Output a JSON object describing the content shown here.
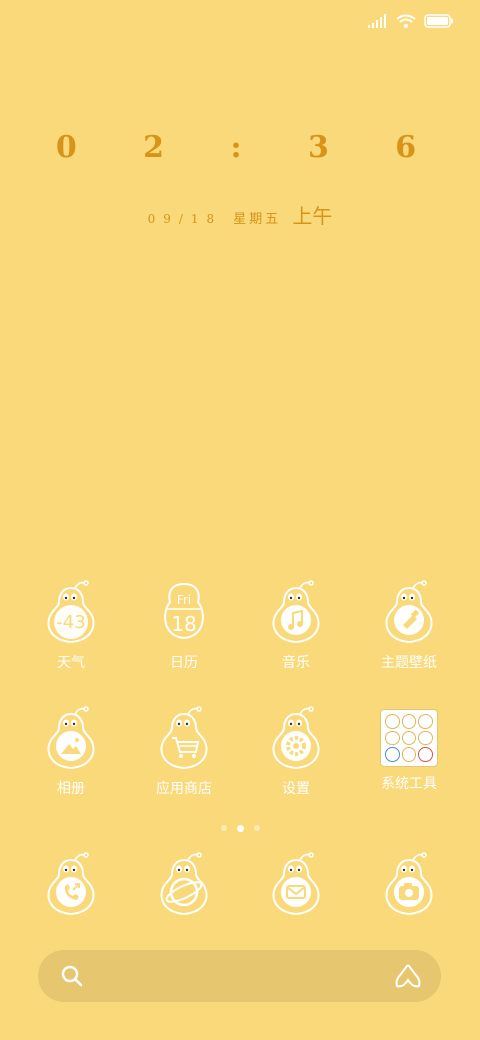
{
  "status_bar": {
    "signal_icon": "signal-bars-icon",
    "wifi_icon": "wifi-icon",
    "battery_icon": "battery-icon"
  },
  "clock": {
    "time": "0 2 : 3 6",
    "date": "09/18",
    "weekday": "星期五",
    "ampm": "上午"
  },
  "apps_row1": [
    {
      "label": "天气",
      "icon": "weather-icon",
      "value": "-43"
    },
    {
      "label": "日历",
      "icon": "calendar-icon",
      "day": "Fri",
      "date": "18"
    },
    {
      "label": "音乐",
      "icon": "music-icon"
    },
    {
      "label": "主题壁纸",
      "icon": "theme-brush-icon"
    }
  ],
  "apps_row2": [
    {
      "label": "相册",
      "icon": "gallery-icon"
    },
    {
      "label": "应用商店",
      "icon": "app-store-cart-icon"
    },
    {
      "label": "设置",
      "icon": "settings-gear-icon"
    },
    {
      "label": "系统工具",
      "icon": "system-tools-folder-icon"
    }
  ],
  "dock": [
    {
      "icon": "phone-icon"
    },
    {
      "icon": "browser-icon"
    },
    {
      "icon": "messages-icon"
    },
    {
      "icon": "camera-icon"
    }
  ],
  "page_indicator": {
    "count": 3,
    "active": 2
  },
  "search_bar": {
    "search_icon": "search-icon",
    "assistant_icon": "assistant-icon"
  },
  "colors": {
    "background": "#F9D97A",
    "clock": "#D99318",
    "search_bar": "#E6C66E"
  }
}
